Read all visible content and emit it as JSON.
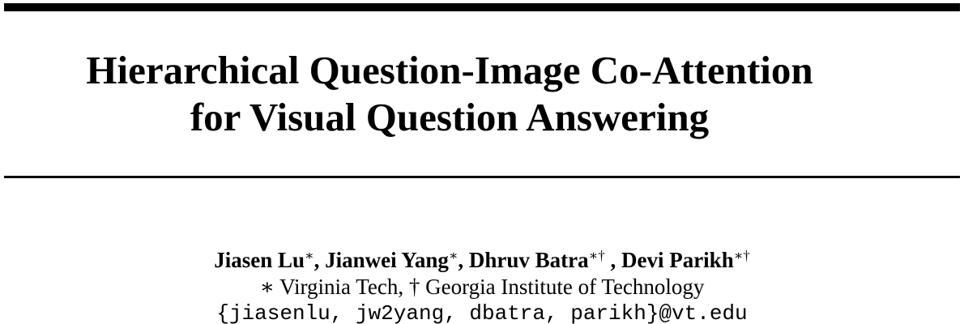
{
  "title": {
    "line1": "Hierarchical Question-Image Co-Attention",
    "line2": "for Visual Question Answering"
  },
  "authors": [
    {
      "name": "Jiasen Lu",
      "mark": "∗",
      "sep": ", "
    },
    {
      "name": "Jianwei Yang",
      "mark": "∗",
      "sep": ", "
    },
    {
      "name": "Dhruv Batra",
      "mark": "∗†",
      "sep": " , "
    },
    {
      "name": "Devi Parikh",
      "mark": "∗†",
      "sep": ""
    }
  ],
  "affiliations": "∗ Virginia Tech, † Georgia Institute of Technology",
  "email": "{jiasenlu, jw2yang, dbatra, parikh}@vt.edu"
}
